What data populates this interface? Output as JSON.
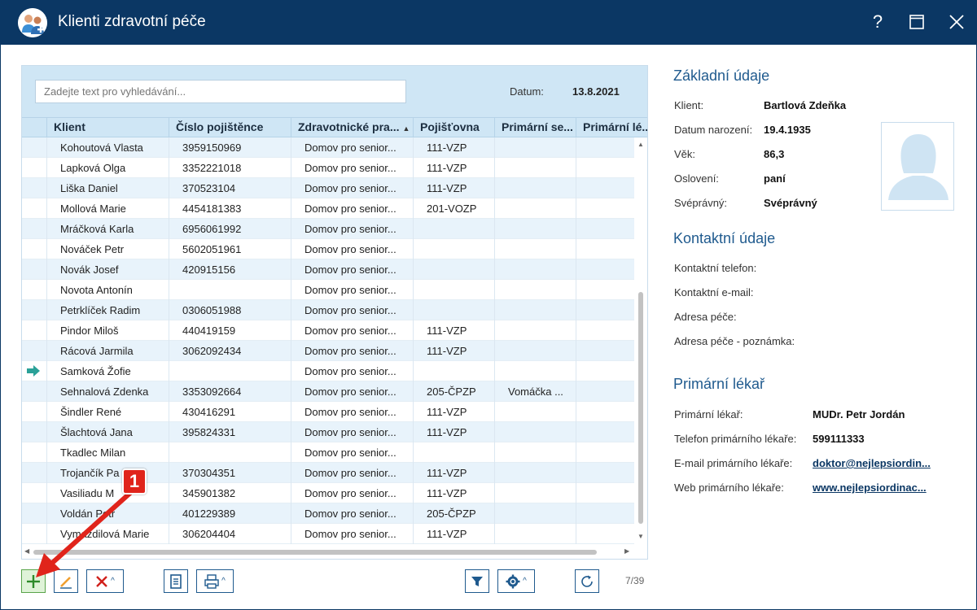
{
  "window": {
    "title": "Klienti zdravotní péče",
    "help_glyph": "?",
    "maximize_glyph": "☐",
    "close_glyph": "✕"
  },
  "search": {
    "placeholder": "Zadejte text pro vyhledávání...",
    "date_label": "Datum:",
    "date_value": "13.8.2021"
  },
  "grid": {
    "columns": [
      "Klient",
      "Číslo pojištěnce",
      "Zdravotnické pra...",
      "Pojišťovna",
      "Primární se...",
      "Primární lé..."
    ],
    "sorted_column_index": 2,
    "current_row_index": 11,
    "rows": [
      [
        "Kohoutová Vlasta",
        "3959150969",
        "Domov pro senior...",
        "111-VZP",
        "",
        ""
      ],
      [
        "Lapková Olga",
        "3352221018",
        "Domov pro senior...",
        "111-VZP",
        "",
        ""
      ],
      [
        "Liška Daniel",
        "370523104",
        "Domov pro senior...",
        "111-VZP",
        "",
        ""
      ],
      [
        "Mollová Marie",
        "4454181383",
        "Domov pro senior...",
        "201-VOZP",
        "",
        ""
      ],
      [
        "Mráčková Karla",
        "6956061992",
        "Domov pro senior...",
        "",
        "",
        ""
      ],
      [
        "Nováček Petr",
        "5602051961",
        "Domov pro senior...",
        "",
        "",
        ""
      ],
      [
        "Novák Josef",
        "420915156",
        "Domov pro senior...",
        "",
        "",
        ""
      ],
      [
        "Novota Antonín",
        "",
        "Domov pro senior...",
        "",
        "",
        ""
      ],
      [
        "Petrklíček Radim",
        "0306051988",
        "Domov pro senior...",
        "",
        "",
        ""
      ],
      [
        "Pindor Miloš",
        "440419159",
        "Domov pro senior...",
        "111-VZP",
        "",
        ""
      ],
      [
        "Rácová Jarmila",
        "3062092434",
        "Domov pro senior...",
        "111-VZP",
        "",
        ""
      ],
      [
        "Samková Žofie",
        "",
        "Domov pro senior...",
        "",
        "",
        ""
      ],
      [
        "Sehnalová Zdenka",
        "3353092664",
        "Domov pro senior...",
        "205-ČPZP",
        "Vomáčka ...",
        ""
      ],
      [
        "Šindler René",
        "430416291",
        "Domov pro senior...",
        "111-VZP",
        "",
        ""
      ],
      [
        "Šlachtová Jana",
        "395824331",
        "Domov pro senior...",
        "111-VZP",
        "",
        ""
      ],
      [
        "Tkadlec Milan",
        "",
        "Domov pro senior...",
        "",
        "",
        ""
      ],
      [
        "Trojančík Pa",
        "370304351",
        "Domov pro senior...",
        "111-VZP",
        "",
        ""
      ],
      [
        "Vasiliadu M",
        "345901382",
        "Domov pro senior...",
        "111-VZP",
        "",
        ""
      ],
      [
        "Voldán Petr",
        "401229389",
        "Domov pro senior...",
        "205-ČPZP",
        "",
        ""
      ],
      [
        "Vymazdilová Marie",
        "306204404",
        "Domov pro senior...",
        "111-VZP",
        "",
        ""
      ]
    ]
  },
  "toolbar": {
    "counter": "7/39"
  },
  "detail": {
    "basic": {
      "title": "Základní údaje",
      "client_label": "Klient:",
      "client_value": "Bartlová Zdeňka",
      "birth_label": "Datum narození:",
      "birth_value": "19.4.1935",
      "age_label": "Věk:",
      "age_value": "86,3",
      "salutation_label": "Oslovení:",
      "salutation_value": "paní",
      "competent_label": "Svéprávný:",
      "competent_value": "Svéprávný"
    },
    "contact": {
      "title": "Kontaktní údaje",
      "phone_label": "Kontaktní telefon:",
      "email_label": "Kontaktní e-mail:",
      "address_label": "Adresa péče:",
      "address_note_label": "Adresa péče - poznámka:"
    },
    "doctor": {
      "title": "Primární lékař",
      "doctor_label": "Primární lékař:",
      "doctor_value": "MUDr. Petr Jordán",
      "phone_label": "Telefon primárního lékaře:",
      "phone_value": "599111333",
      "email_label": "E-mail primárního lékaře:",
      "email_value": "doktor@nejlepsiordin...",
      "web_label": "Web primárního lékaře:",
      "web_value": "www.nejlepsiordinac..."
    }
  },
  "annotation": {
    "badge": "1",
    "color": "#e0241b"
  },
  "colors": {
    "titlebar": "#0b3764",
    "accent": "#1f5a8e",
    "row_alt": "#e8f3fb"
  }
}
